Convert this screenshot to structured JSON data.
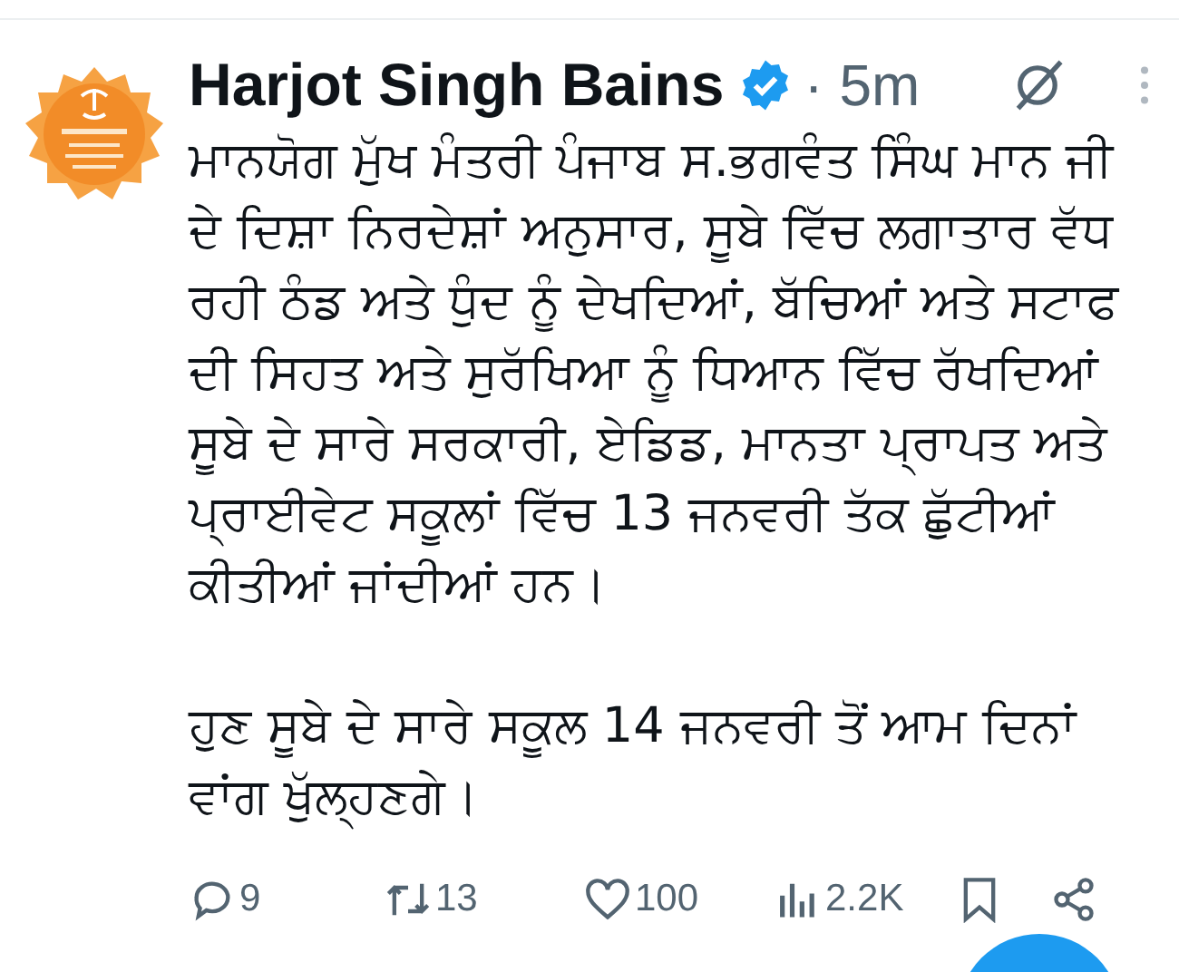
{
  "author": {
    "name": "Harjot Singh Bains",
    "verified": true,
    "time": "· 5m"
  },
  "paragraphs": [
    "ਮਾਨਯੋਗ ਮੁੱਖ ਮੰਤਰੀ ਪੰਜਾਬ ਸ.ਭਗਵੰਤ ਸਿੰਘ ਮਾਨ ਜੀ ਦੇ ਦਿਸ਼ਾ ਨਿਰਦੇਸ਼ਾਂ ਅਨੁਸਾਰ, ਸੂਬੇ ਵਿੱਚ ਲਗਾਤਾਰ ਵੱਧ ਰਹੀ ਠੰਡ ਅਤੇ ਧੁੰਦ ਨੂੰ ਦੇਖਦਿਆਂ, ਬੱਚਿਆਂ ਅਤੇ ਸਟਾਫ ਦੀ ਸਿਹਤ ਅਤੇ ਸੁਰੱਖਿਆ ਨੂੰ ਧਿਆਨ ਵਿੱਚ ਰੱਖਦਿਆਂ ਸੂਬੇ ਦੇ ਸਾਰੇ ਸਰਕਾਰੀ, ਏਡਿਡ, ਮਾਨਤਾ ਪ੍ਰਾਪਤ ਅਤੇ ਪ੍ਰਾਈਵੇਟ ਸਕੂਲਾਂ ਵਿੱਚ 13 ਜਨਵਰੀ ਤੱਕ ਛੁੱਟੀਆਂ ਕੀਤੀਆਂ ਜਾਂਦੀਆਂ ਹਨ।",
    "ਹੁਣ ਸੂਬੇ ਦੇ ਸਾਰੇ ਸਕੂਲ 14 ਜਨਵਰੀ ਤੋਂ ਆਮ ਦਿਨਾਂ ਵਾਂਗ ਖੁੱਲ੍ਹਣਗੇ।"
  ],
  "actions": [
    {
      "kind": "reply",
      "count": "9"
    },
    {
      "kind": "repost",
      "count": "13"
    },
    {
      "kind": "like",
      "count": "100"
    },
    {
      "kind": "views",
      "count": "2.2K"
    },
    {
      "kind": "bookmark"
    },
    {
      "kind": "share"
    }
  ]
}
